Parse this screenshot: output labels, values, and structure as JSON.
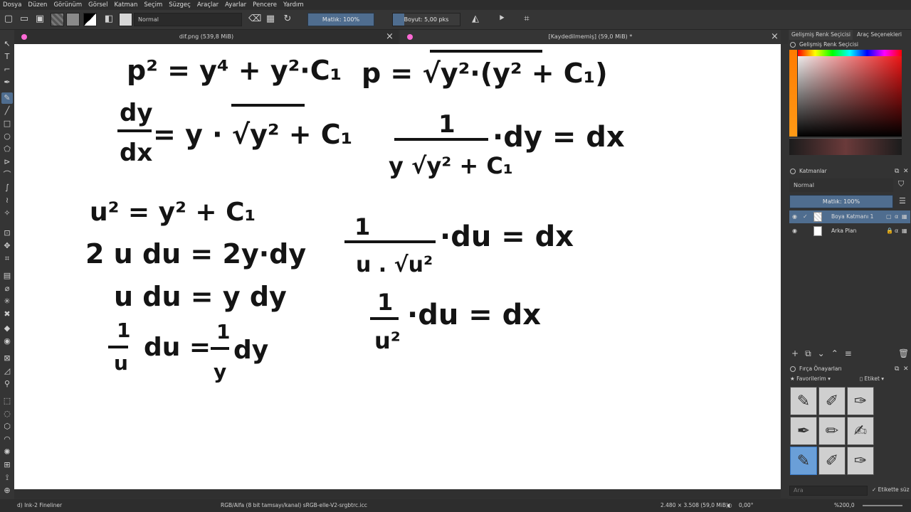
{
  "menu": [
    "Dosya",
    "Düzen",
    "Görünüm",
    "Görsel",
    "Katman",
    "Seçim",
    "Süzgeç",
    "Araçlar",
    "Ayarlar",
    "Pencere",
    "Yardım"
  ],
  "toolbar": {
    "blend_mode": "Normal",
    "opacity": "Matlık: 100%",
    "size": "Boyut: 5,00 pks"
  },
  "tabs": {
    "left": "dif.png (539,8 MiB)",
    "right": "[Kaydedilmemiş]  (59,0 MiB) *"
  },
  "dock": {
    "tab_color": "Gelişmiş Renk Seçicisi",
    "tab_tools": "Araç Seçenekleri",
    "color_panel": "Gelişmiş Renk Seçicisi",
    "layers_panel": "Katmanlar",
    "layer_blend": "Normal",
    "layer_opacity": "Matlık:  100%",
    "layers": [
      {
        "name": "Boya Katmanı 1",
        "selected": true
      },
      {
        "name": "Arka Plan",
        "selected": false
      }
    ],
    "brush_panel": "Fırça Önayarları",
    "favorites": "Favorilerim",
    "tag": "Etiket",
    "search_placeholder": "Ara",
    "filter_label": "Etikette süz"
  },
  "canvas": {
    "eq1a": "p² = y⁴ + y²·C₁",
    "eq1b": "p = √y²·(y² + C₁)",
    "eq2_num": "dy",
    "eq2_den": "dx",
    "eq2_rhs": "= y · √y² + C₁",
    "eq3_num": "1",
    "eq3_den": "y √y² + C₁",
    "eq3_rhs": "·dy = dx",
    "eq4": "u² = y² + C₁",
    "eq5": "2 u du = 2y·dy",
    "eq6": "u du = y dy",
    "eq7_n1": "1",
    "eq7_d1": "u",
    "eq7_mid": "du =",
    "eq7_n2": "1",
    "eq7_d2": "y",
    "eq7_end": "dy",
    "eq8_num": "1",
    "eq8_den": "u . √u²",
    "eq8_rhs": "·du = dx",
    "eq9_num": "1",
    "eq9_den": "u²",
    "eq9_rhs": "·du  = dx"
  },
  "status": {
    "brush": "d) Ink-2 Fineliner",
    "color_profile": "RGB/Alfa (8 bit tamsayı/kanal)  sRGB-elle-V2-srgbtrc.icc",
    "dimensions": "2.480 × 3.508 (59,0 MiB)",
    "rotation": "0,00°",
    "zoom": "%200,0"
  }
}
